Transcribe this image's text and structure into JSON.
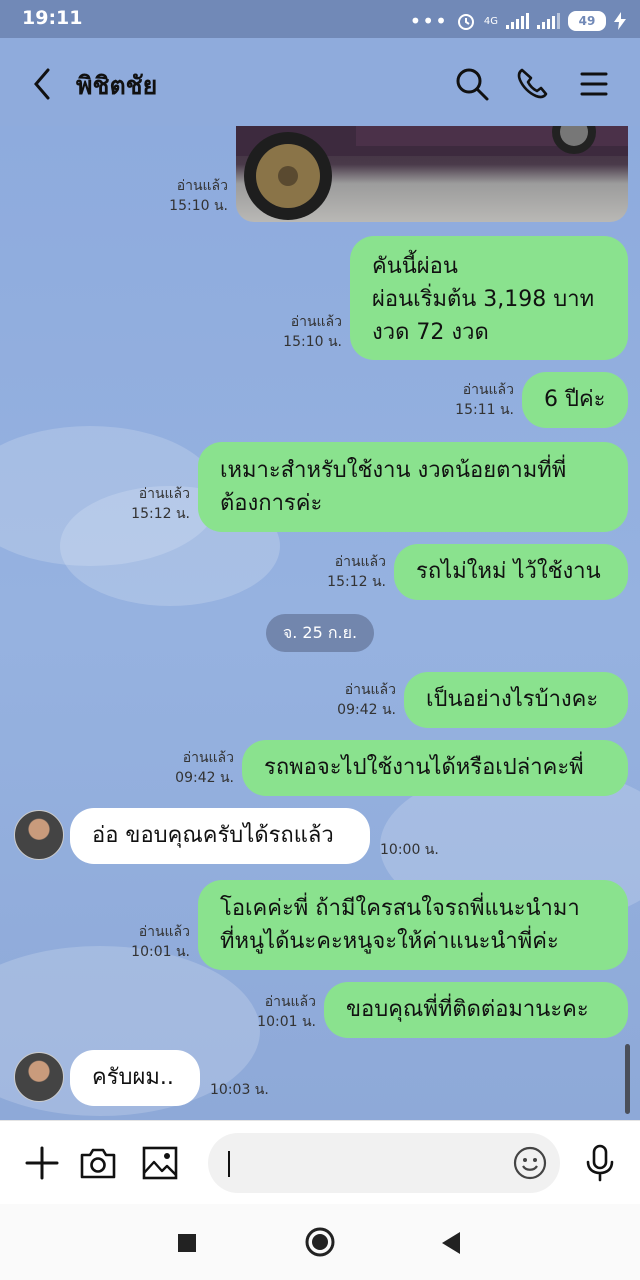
{
  "status_bar": {
    "time": "19:11",
    "network": "4G",
    "battery": "49"
  },
  "header": {
    "contact_name": "พิชิตชัย"
  },
  "messages": [
    {
      "status": "อ่านแล้ว",
      "time": "15:10 น."
    },
    {
      "lines": [
        "คันนี้ผ่อน",
        "ผ่อนเริ่มต้น 3,198 บาท",
        "งวด 72 งวด"
      ],
      "status": "อ่านแล้ว",
      "time": "15:10 น."
    },
    {
      "lines": [
        "6 ปีค่ะ"
      ],
      "status": "อ่านแล้ว",
      "time": "15:11 น."
    },
    {
      "lines": [
        "เหมาะสำหรับใช้งาน งวดน้อยตามที่พี่",
        "ต้องการค่ะ"
      ],
      "status": "อ่านแล้ว",
      "time": "15:12 น."
    },
    {
      "lines": [
        "รถไม่ใหม่ ไว้ใช้งาน"
      ],
      "status": "อ่านแล้ว",
      "time": "15:12 น."
    },
    {
      "lines": [
        "เป็นอย่างไรบ้างคะ"
      ],
      "status": "อ่านแล้ว",
      "time": "09:42 น."
    },
    {
      "lines": [
        "รถพอจะไปใช้งานได้หรือเปล่าคะพี่"
      ],
      "status": "อ่านแล้ว",
      "time": "09:42 น."
    },
    {
      "lines": [
        "อ่อ ขอบคุณครับได้รถแล้ว"
      ],
      "time": "10:00 น."
    },
    {
      "lines": [
        "โอเคค่ะพี่ ถ้ามีใครสนใจรถพี่แนะนำมา",
        "ที่หนูได้นะคะหนูจะให้ค่าแนะนำพี่ค่ะ"
      ],
      "status": "อ่านแล้ว",
      "time": "10:01 น."
    },
    {
      "lines": [
        "ขอบคุณพี่ที่ติดต่อมานะคะ"
      ],
      "status": "อ่านแล้ว",
      "time": "10:01 น."
    },
    {
      "lines": [
        "ครับผม.."
      ],
      "time": "10:03 น."
    }
  ],
  "date_separator": "จ. 25 ก.ย.",
  "colors": {
    "chat_bg": "#8fabdc",
    "sent_bubble": "#8ae28e",
    "received_bubble": "#ffffff",
    "status_bar": "#7189b7"
  },
  "icons": [
    "back-arrow-icon",
    "search-icon",
    "phone-icon",
    "menu-icon",
    "plus-icon",
    "camera-icon",
    "image-icon",
    "emoji-icon",
    "microphone-icon"
  ]
}
